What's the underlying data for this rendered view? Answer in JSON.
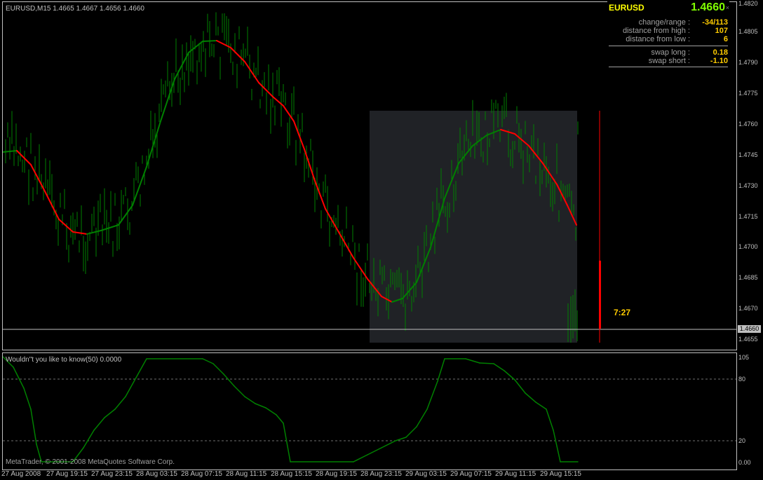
{
  "chart": {
    "title": "EURUSD,M15  1.4665 1.4667 1.4656 1.4660",
    "symbol": "EURUSD",
    "bid": "1.4660",
    "current_price": "1.4660",
    "timer": "7:27",
    "colors": {
      "up": "#008000",
      "down": "#ff0000",
      "grid": "#c0c0c0",
      "box": "#202226"
    }
  },
  "info_panel": {
    "close_icon": "x-icon",
    "rows": [
      {
        "label": "change/range :",
        "value": "-34/113",
        "color": "#ffcc00"
      },
      {
        "label": "distance from high :",
        "value": "107",
        "color": "#ffcc00"
      },
      {
        "label": "distance from low :",
        "value": "6",
        "color": "#ffcc00"
      },
      {
        "label": "swap long :",
        "value": "0.18",
        "color": "#ffcc00"
      },
      {
        "label": "swap short :",
        "value": "-1.10",
        "color": "#ffcc00"
      }
    ]
  },
  "price_axis": [
    "1.4820",
    "1.4805",
    "1.4790",
    "1.4775",
    "1.4760",
    "1.4745",
    "1.4730",
    "1.4715",
    "1.4700",
    "1.4685",
    "1.4670",
    "1.4655"
  ],
  "indicator": {
    "title": "Wouldn\"t you like to know(50) 0.0000",
    "axis": [
      "105",
      "80",
      "20",
      "0.00"
    ],
    "copyright": "MetaTrader, © 2001-2008 MetaQuotes Software Corp."
  },
  "time_axis": [
    "27 Aug 2008",
    "27 Aug 19:15",
    "27 Aug 23:15",
    "28 Aug 03:15",
    "28 Aug 07:15",
    "28 Aug 11:15",
    "28 Aug 15:15",
    "28 Aug 19:15",
    "28 Aug 23:15",
    "29 Aug 03:15",
    "29 Aug 07:15",
    "29 Aug 11:15",
    "29 Aug 15:15"
  ]
}
